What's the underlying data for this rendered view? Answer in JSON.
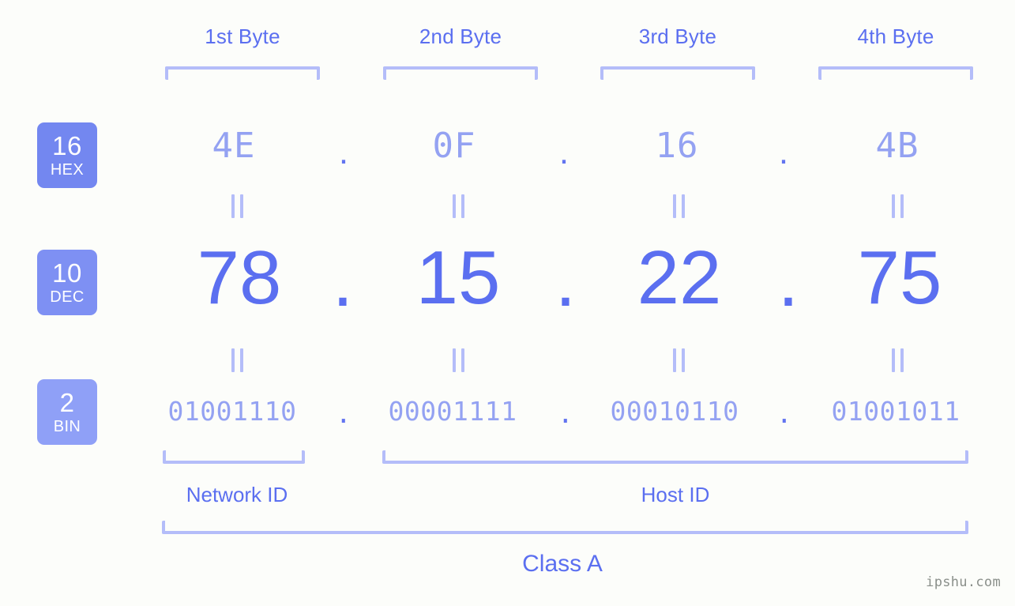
{
  "background_color": "#fcfdfa",
  "accent_color": "#5b6ff0",
  "accent_light_color": "#94a2f2",
  "bracket_color": "#b4bdf9",
  "badge_hex_color": "#7387f0",
  "badge_dec_color": "#7e90f3",
  "badge_bin_color": "#8fa0f7",
  "bytes": {
    "headers": [
      {
        "label": "1st Byte"
      },
      {
        "label": "2nd Byte"
      },
      {
        "label": "3rd Byte"
      },
      {
        "label": "4th Byte"
      }
    ]
  },
  "rows": {
    "hex": {
      "badge_number": "16",
      "badge_base": "HEX",
      "values": [
        "4E",
        "0F",
        "16",
        "4B"
      ],
      "separator": "."
    },
    "dec": {
      "badge_number": "10",
      "badge_base": "DEC",
      "values": [
        "78",
        "15",
        "22",
        "75"
      ],
      "separator": "."
    },
    "bin": {
      "badge_number": "2",
      "badge_base": "BIN",
      "values": [
        "01001110",
        "00001111",
        "00010110",
        "01001011"
      ],
      "separator": "."
    }
  },
  "equals_mark": "=",
  "footer": {
    "network_id_label": "Network ID",
    "host_id_label": "Host ID",
    "class_label": "Class A"
  },
  "watermark": "ipshu.com"
}
